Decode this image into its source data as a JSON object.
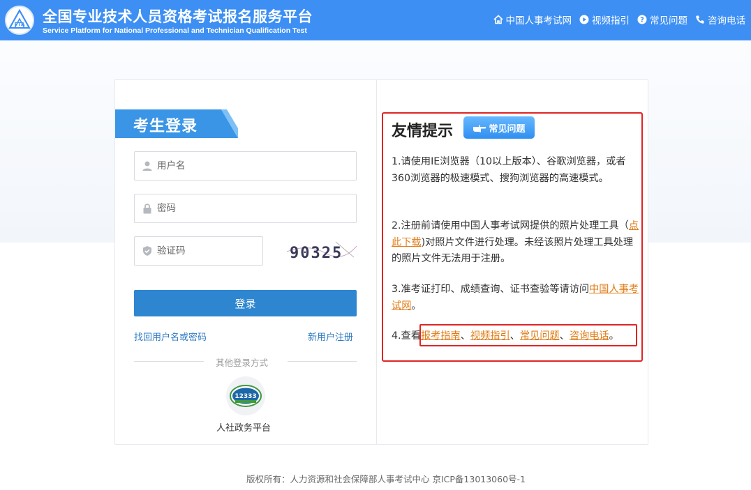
{
  "header": {
    "logo_text": "PTA",
    "title": "全国专业技术人员资格考试报名服务平台",
    "subtitle": "Service Platform for National Professional and Technician Qualification Test",
    "nav": [
      {
        "label": "中国人事考试网",
        "icon": "home-icon"
      },
      {
        "label": "视频指引",
        "icon": "play-icon"
      },
      {
        "label": "常见问题",
        "icon": "question-icon"
      },
      {
        "label": "咨询电话",
        "icon": "phone-icon"
      }
    ]
  },
  "login": {
    "tab_title": "考生登录",
    "username_placeholder": "用户名",
    "password_placeholder": "密码",
    "captcha_placeholder": "验证码",
    "captcha_text": "90325",
    "login_button": "登录",
    "forgot_link": "找回用户名或密码",
    "register_link": "新用户注册",
    "other_methods": "其他登录方式",
    "gov_platform_label": "人社政务平台",
    "gov_badge_text": "12333"
  },
  "tips": {
    "title": "友情提示",
    "faq_button": "常见问题",
    "tip1": "1.请使用IE浏览器（10以上版本）、谷歌浏览器，或者360浏览器的极速模式、搜狗浏览器的高速模式。",
    "tip2_before": "2.注册前请使用中国人事考试网提供的照片处理工具（",
    "tip2_link": "点此下载",
    "tip2_after": ")对照片文件进行处理。未经该照片处理工具处理的照片文件无法用于注册。",
    "tip3_before": "3.准考证打印、成绩查询、证书查验等请访问",
    "tip3_link": "中国人事考试网",
    "tip3_after": "。",
    "tip4_before": "4.查看",
    "tip4_links": [
      "报考指南",
      "视频指引",
      "常见问题",
      "咨询电话"
    ],
    "tip4_separator": "、",
    "tip4_after": "。"
  },
  "footer": {
    "copyright": "版权所有：人力资源和社会保障部人事考试中心 京ICP备13013060号-1"
  },
  "colors": {
    "header_blue": "#3d8ff4",
    "button_blue": "#2f86d0",
    "link_orange": "#e07b14",
    "highlight_red": "#e02424"
  }
}
